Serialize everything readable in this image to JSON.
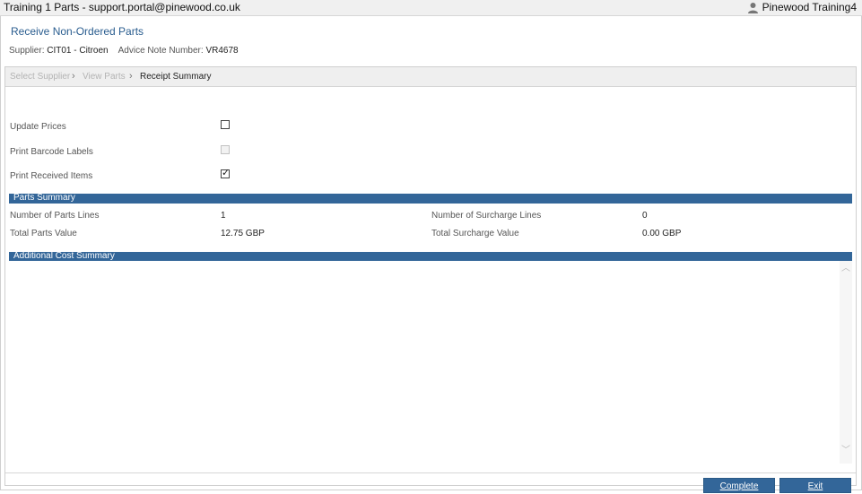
{
  "window": {
    "title": "Training 1 Parts - support.portal@pinewood.co.uk",
    "user": "Pinewood Training4"
  },
  "header": {
    "title": "Receive Non-Ordered Parts",
    "supplier_label": "Supplier:",
    "supplier_value": "CIT01 - Citroen",
    "advice_label": "Advice Note Number:",
    "advice_value": "VR4678"
  },
  "breadcrumb": {
    "step1": "Select Supplier",
    "step2": "View Parts",
    "step3": "Receipt Summary"
  },
  "options": {
    "update_prices": {
      "label": "Update Prices",
      "checked": false
    },
    "print_barcode": {
      "label": "Print Barcode Labels",
      "checked": false,
      "disabled": true
    },
    "print_received": {
      "label": "Print Received Items",
      "checked": true
    }
  },
  "parts_summary": {
    "title": "Parts Summary",
    "num_parts_lines_label": "Number of Parts Lines",
    "num_parts_lines_value": "1",
    "total_parts_value_label": "Total Parts Value",
    "total_parts_value_value": "12.75 GBP",
    "num_surcharge_lines_label": "Number of Surcharge Lines",
    "num_surcharge_lines_value": "0",
    "total_surcharge_value_label": "Total Surcharge Value",
    "total_surcharge_value_value": "0.00 GBP"
  },
  "additional_cost": {
    "title": "Additional Cost Summary"
  },
  "buttons": {
    "complete": "Complete",
    "exit": "Exit"
  },
  "colors": {
    "accent": "#336699",
    "title_blue": "#2a5d8f"
  }
}
